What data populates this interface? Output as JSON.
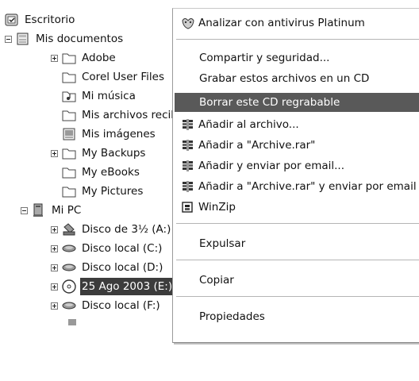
{
  "tree": {
    "items": [
      {
        "label": "Escritorio"
      },
      {
        "label": "Mis documentos"
      },
      {
        "label": "Adobe"
      },
      {
        "label": "Corel User Files"
      },
      {
        "label": "Mi música"
      },
      {
        "label": "Mis archivos recibidos"
      },
      {
        "label": "Mis imágenes"
      },
      {
        "label": "My Backups"
      },
      {
        "label": "My eBooks"
      },
      {
        "label": "My Pictures"
      },
      {
        "label": "Mi PC"
      },
      {
        "label": "Disco de 3½ (A:)"
      },
      {
        "label": "Disco local (C:)"
      },
      {
        "label": "Disco local (D:)"
      },
      {
        "label": "25 Ago 2003 (E:)"
      },
      {
        "label": "Disco local (F:)"
      }
    ]
  },
  "menu": {
    "items": [
      {
        "label": "Analizar con antivirus Platinum",
        "icon": "antivirus-icon"
      },
      {
        "label": "Compartir y seguridad..."
      },
      {
        "label": "Grabar estos archivos en un CD"
      },
      {
        "label": "Borrar este CD regrabable",
        "highlighted": true
      },
      {
        "label": "Añadir al archivo...",
        "icon": "winrar-icon"
      },
      {
        "label": "Añadir a \"Archive.rar\"",
        "icon": "winrar-icon"
      },
      {
        "label": "Añadir y enviar por email...",
        "icon": "winrar-icon"
      },
      {
        "label": "Añadir a \"Archive.rar\" y enviar por email",
        "icon": "winrar-icon"
      },
      {
        "label": "WinZip",
        "icon": "winzip-icon"
      },
      {
        "label": "Expulsar"
      },
      {
        "label": "Copiar"
      },
      {
        "label": "Propiedades"
      }
    ]
  },
  "colors": {
    "highlight": "#595959",
    "selection": "#3c3c3c"
  }
}
